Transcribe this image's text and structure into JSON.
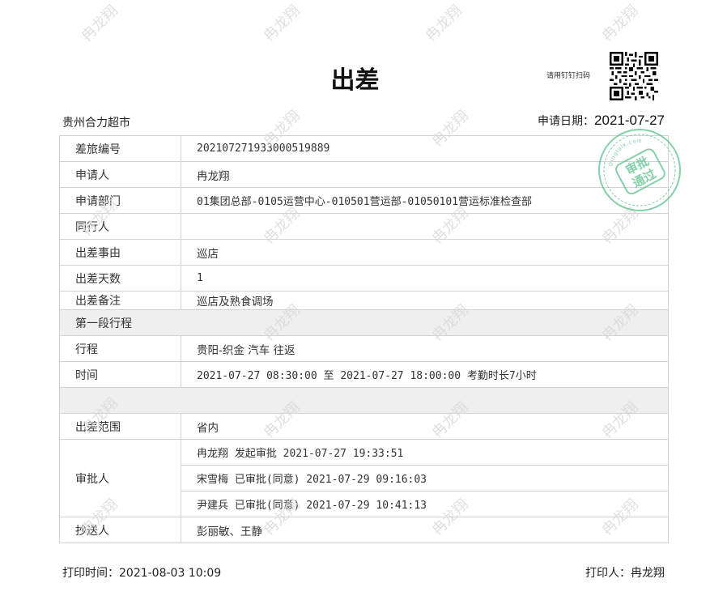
{
  "title": "出差",
  "qr_hint": "请用钉钉扫码",
  "company": "贵州合力超市",
  "apply_date": {
    "label": "申请日期：",
    "value": "2021-07-27"
  },
  "rows": {
    "trip_no": {
      "label": "差旅编号",
      "value": "202107271933000519889"
    },
    "applicant": {
      "label": "申请人",
      "value": "冉龙翔"
    },
    "department": {
      "label": "申请部门",
      "value": "01集团总部-0105运营中心-010501营运部-01050101营运标准检查部"
    },
    "companions": {
      "label": "同行人",
      "value": ""
    },
    "reason": {
      "label": "出差事由",
      "value": "巡店"
    },
    "days": {
      "label": "出差天数",
      "value": "1"
    },
    "remark": {
      "label": "出差备注",
      "value": "巡店及熟食调场"
    },
    "segment_title": "第一段行程",
    "itinerary": {
      "label": "行程",
      "value": "贵阳-织金 汽车 往返"
    },
    "time": {
      "label": "时间",
      "value": "2021-07-27 08:30:00 至 2021-07-27 18:00:00 考勤时长7小时"
    },
    "scope": {
      "label": "出差范围",
      "value": "省内"
    },
    "approvers": {
      "label": "审批人",
      "items": [
        "冉龙翔 发起审批  2021-07-27 19:33:51",
        "宋雪梅 已审批(同意)  2021-07-29 09:16:03",
        "尹建兵 已审批(同意)  2021-07-29 10:41:13"
      ]
    },
    "cc": {
      "label": "抄送人",
      "value": "彭丽敏、王静"
    }
  },
  "stamp": {
    "line1": "审批",
    "line2": "通过",
    "brand": "Dingtalk.com"
  },
  "watermark_text": "冉龙翔",
  "print_time": {
    "label": "打印时间：",
    "value": "2021-08-03 10:09"
  },
  "printer": {
    "label": "打印人：",
    "value": "冉龙翔"
  },
  "colors": {
    "border": "#d2d2d2",
    "section_bg": "#efefef",
    "stamp": "#5cc28c",
    "watermark": "#d9d9d9"
  }
}
